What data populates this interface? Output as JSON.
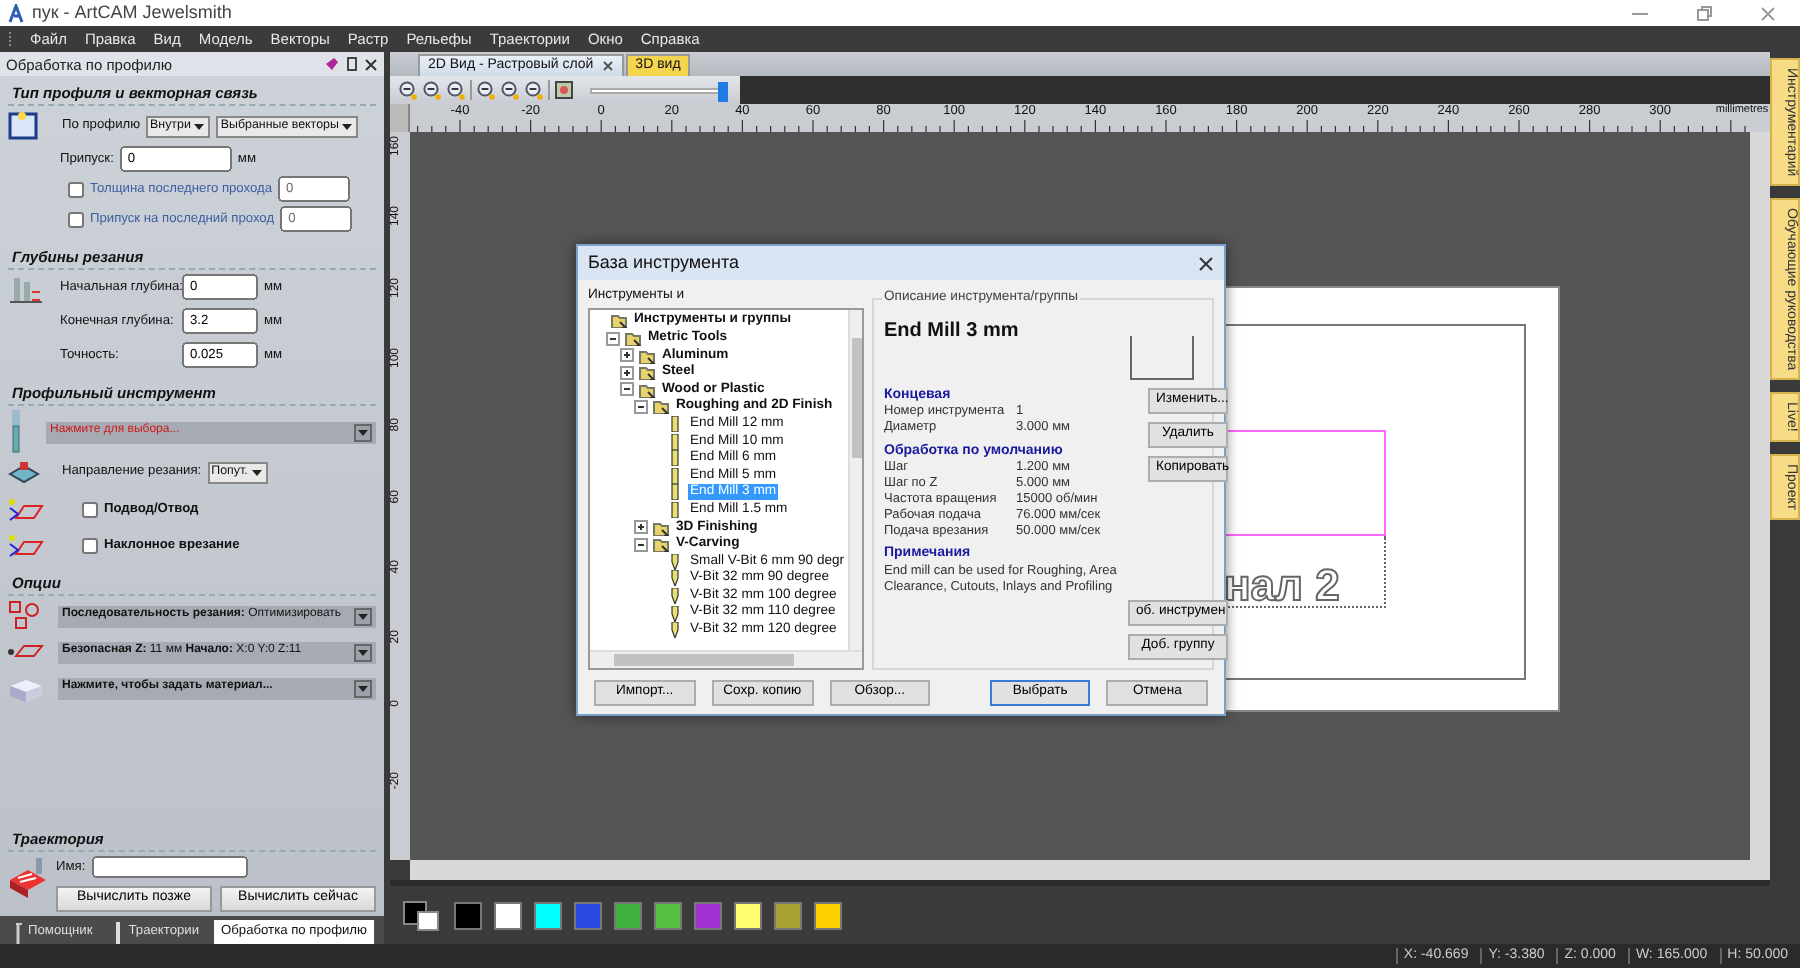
{
  "window": {
    "title": "пук - ArtCAM Jewelsmith"
  },
  "menu": [
    "Файл",
    "Правка",
    "Вид",
    "Модель",
    "Векторы",
    "Растр",
    "Рельефы",
    "Траектории",
    "Окно",
    "Справка"
  ],
  "left_panel": {
    "title": "Обработка по профилю",
    "profile_type": {
      "heading": "Тип профиля и векторная связь",
      "profile_label": "По профилю",
      "side": "Внутри",
      "vectors": "Выбранные векторы",
      "allowance_label": "Припуск:",
      "allowance": "0",
      "unit": "мм",
      "options": [
        {
          "label": "Толщина последнего прохода",
          "checked": false,
          "value": "0"
        },
        {
          "label": "Припуск на последний проход",
          "checked": false,
          "value": "0"
        }
      ]
    },
    "depths": {
      "heading": "Глубины резания",
      "fields": [
        {
          "label": "Начальная глубина:",
          "value": "0",
          "unit": "мм"
        },
        {
          "label": "Конечная глубина:",
          "value": "3.2",
          "unit": "мм"
        },
        {
          "label": "Точность:",
          "value": "0.025",
          "unit": "мм"
        }
      ]
    },
    "tool": {
      "heading": "Профильный инструмент",
      "prompt": "Нажмите для выбора...",
      "direction_label": "Направление резания:",
      "direction": "Попут.",
      "options": [
        {
          "label": "Подвод/Отвод",
          "checked": false
        },
        {
          "label": "Наклонное врезание",
          "checked": false
        }
      ]
    },
    "options": {
      "heading": "Опции",
      "rows": [
        {
          "kind": "setting",
          "text": "**Последовательность резания:** Оптимизировать"
        },
        {
          "kind": "setting",
          "text": "**Безопасная Z:** 11 мм **Начало:** X:0 Y:0 Z:11"
        },
        {
          "kind": "prompt",
          "text": "Нажмите, чтобы задать материал..."
        }
      ]
    },
    "toolpath": {
      "heading": "Траектория",
      "name_label": "Имя:",
      "buttons": [
        "Вычислить позже",
        "Вычислить сейчас"
      ]
    },
    "tabs": [
      {
        "label": "Помощник",
        "selected": false
      },
      {
        "label": "Траектории",
        "selected": false
      },
      {
        "label": "Обработка по профилю",
        "selected": true
      }
    ]
  },
  "view_tabs": [
    {
      "label": "2D Вид - Растровый слой",
      "selected": true
    },
    {
      "label": "3D вид",
      "selected": false
    }
  ],
  "zoom_slider": {
    "level": 1
  },
  "ruler": {
    "labels": [
      "-40",
      "-20",
      "0",
      "20",
      "40",
      "60",
      "80",
      "100",
      "120",
      "140",
      "160",
      "180",
      "200",
      "220",
      "240",
      "260",
      "280",
      "300"
    ],
    "unit": "millimetres"
  },
  "vertical_ruler": {
    "labels": [
      "160",
      "140",
      "120",
      "100",
      "80",
      "60",
      "40",
      "20",
      "0",
      "-20"
    ]
  },
  "canvas": {
    "text": "нал 2"
  },
  "palette": [
    {
      "color": "#000000"
    },
    {
      "color": "#ffffff"
    },
    {
      "color": "#00ffff"
    },
    {
      "color": "#2848e0"
    },
    {
      "color": "#40b040"
    },
    {
      "color": "#58c040"
    },
    {
      "color": "#a030d0"
    },
    {
      "color": "#ffff70"
    },
    {
      "color": "#a8a030"
    },
    {
      "color": "#ffd000"
    }
  ],
  "right_tabs": [
    "Инструментарий",
    "Обучающие руководства",
    "Live!",
    "Проект"
  ],
  "status_bar": [
    "X: -40.669",
    "Y: -3.380",
    "Z: 0.000",
    "W: 165.000",
    "H: 50.000"
  ],
  "dialog": {
    "title": "База инструмента",
    "tree_label": "Инструменты и",
    "tree": [
      {
        "label": "Инструменты и группы",
        "kind": "group",
        "selected": false,
        "children": [
          {
            "label": "Metric Tools",
            "kind": "group",
            "expanded": true,
            "selected": false,
            "children": [
              {
                "label": "Aluminum",
                "kind": "group",
                "expanded": false,
                "selected": false
              },
              {
                "label": "Steel",
                "kind": "group",
                "expanded": false,
                "selected": false
              },
              {
                "label": "Wood or Plastic",
                "kind": "group",
                "expanded": true,
                "selected": false,
                "children": [
                  {
                    "label": "Roughing and 2D Finish",
                    "kind": "group",
                    "expanded": true,
                    "selected": false,
                    "children": [
                      {
                        "label": "End Mill 12 mm",
                        "kind": "end_mill",
                        "selected": false
                      },
                      {
                        "label": "End Mill 10 mm",
                        "kind": "end_mill",
                        "selected": false
                      },
                      {
                        "label": "End Mill 6 mm",
                        "kind": "end_mill",
                        "selected": false
                      },
                      {
                        "label": "End Mill 5 mm",
                        "kind": "end_mill",
                        "selected": false
                      },
                      {
                        "label": "End Mill 3 mm",
                        "kind": "end_mill",
                        "selected": true
                      },
                      {
                        "label": "End Mill 1.5 mm",
                        "kind": "end_mill",
                        "selected": false
                      }
                    ]
                  },
                  {
                    "label": "3D Finishing",
                    "kind": "group",
                    "expanded": false,
                    "selected": false
                  },
                  {
                    "label": "V-Carving",
                    "kind": "group",
                    "expanded": true,
                    "selected": false,
                    "children": [
                      {
                        "label": "Small V-Bit 6 mm 90 degr",
                        "kind": "v_bit",
                        "selected": false
                      },
                      {
                        "label": "V-Bit 32 mm 90 degree",
                        "kind": "v_bit",
                        "selected": false
                      },
                      {
                        "label": "V-Bit 32 mm 100 degree",
                        "kind": "v_bit",
                        "selected": false
                      },
                      {
                        "label": "V-Bit 32 mm 110 degree",
                        "kind": "v_bit",
                        "selected": false
                      },
                      {
                        "label": "V-Bit 32 mm 120 degree",
                        "kind": "v_bit",
                        "selected": false
                      }
                    ]
                  }
                ]
              }
            ]
          }
        ]
      }
    ],
    "group_title": "Описание инструмента/группы",
    "tool_name": "End Mill 3 mm",
    "sections": [
      {
        "heading": "Концевая",
        "rows": [
          {
            "label": "Номер инструмента",
            "value": "1"
          },
          {
            "label": "Диаметр",
            "value": "3.000 мм"
          }
        ]
      },
      {
        "heading": "Обработка по умолчанию",
        "rows": [
          {
            "label": "Шаг",
            "value": "1.200 мм"
          },
          {
            "label": "Шаг по Z",
            "value": "5.000 мм"
          },
          {
            "label": "Частота вращения",
            "value": "15000 об/мин"
          },
          {
            "label": "Рабочая подача",
            "value": "76.000 мм/сек"
          },
          {
            "label": "Подача врезания",
            "value": "50.000 мм/сек"
          }
        ]
      },
      {
        "heading": "Примечания",
        "note": "End mill can be used for Roughing, Area Clearance, Cutouts, Inlays and Profiling"
      }
    ],
    "side_buttons": [
      "Изменить...",
      "Удалить",
      "Копировать"
    ],
    "group_buttons": [
      "об. инструмен",
      "Доб. группу"
    ],
    "bottom_buttons": [
      "Импорт...",
      "Сохр. копию",
      "Обзор..."
    ],
    "action_buttons": [
      "Выбрать",
      "Отмена"
    ]
  }
}
